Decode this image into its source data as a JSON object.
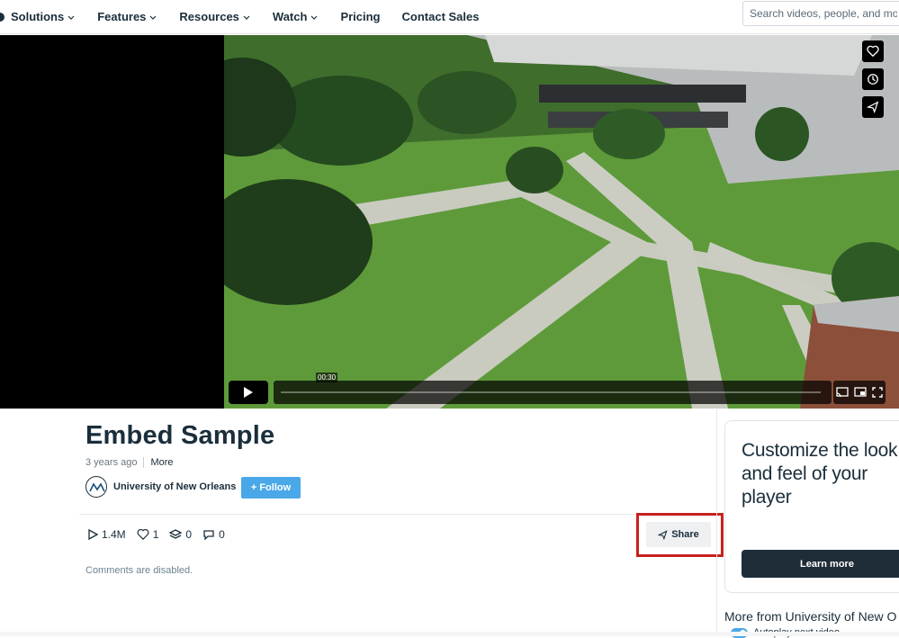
{
  "nav": {
    "items": [
      {
        "label": "Solutions",
        "dropdown": true
      },
      {
        "label": "Features",
        "dropdown": true
      },
      {
        "label": "Resources",
        "dropdown": true
      },
      {
        "label": "Watch",
        "dropdown": true
      },
      {
        "label": "Pricing",
        "dropdown": false
      },
      {
        "label": "Contact Sales",
        "dropdown": false
      }
    ],
    "search_placeholder": "Search videos, people, and more"
  },
  "player": {
    "current_time": "00:30",
    "progress_fraction": 0.0,
    "side_controls": [
      "heart-icon",
      "clock-icon",
      "send-icon"
    ],
    "bottom_controls": [
      "play-icon",
      "cast-icon",
      "pip-icon",
      "fullscreen-icon"
    ]
  },
  "video": {
    "title": "Embed Sample",
    "posted": "3 years ago",
    "more_label": "More",
    "owner": "University of New Orleans",
    "follow_label": "+ Follow",
    "stats": {
      "plays": "1.4M",
      "likes": "1",
      "collections": "0",
      "comments": "0"
    },
    "share_label": "Share",
    "comments_disabled": "Comments are disabled."
  },
  "sidebar": {
    "promo_text": "Customize the look and feel of your player",
    "learn_more": "Learn more",
    "more_from": "More from University of New O",
    "autoplay_label": "Autoplay next video",
    "autoplay_on": true
  },
  "colors": {
    "accent": "#4aa8e8",
    "text_dark": "#1a2e3b",
    "highlight_red": "#c8201e",
    "learn_button": "#1f2d38"
  }
}
